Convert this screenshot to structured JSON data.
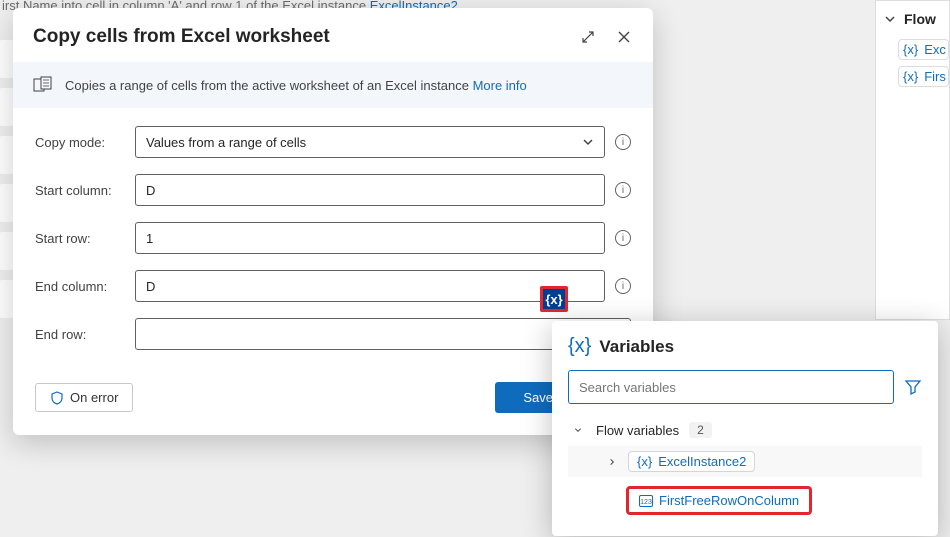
{
  "bg": {
    "text_prefix": "irst Name into cell in column 'A' and row 1 of the Excel instance",
    "text_link": "ExcelInstance2"
  },
  "right_panel": {
    "title": "Flow",
    "vars": [
      "Exc",
      "Firs"
    ]
  },
  "dialog": {
    "title": "Copy cells from Excel worksheet",
    "info": "Copies a range of cells from the active worksheet of an Excel instance",
    "more": "More info",
    "fields": {
      "copy_mode_label": "Copy mode:",
      "copy_mode_value": "Values from a range of cells",
      "start_col_label": "Start column:",
      "start_col_value": "D",
      "start_row_label": "Start row:",
      "start_row_value": "1",
      "end_col_label": "End column:",
      "end_col_value": "D",
      "end_row_label": "End row:",
      "end_row_value": ""
    },
    "expand_badge": "{x}",
    "on_error": "On error",
    "save": "Save"
  },
  "var_popup": {
    "title": "Variables",
    "search_placeholder": "Search variables",
    "group_label": "Flow variables",
    "group_count": "2",
    "vars": [
      {
        "name": "ExcelInstance2",
        "icon": "brace"
      },
      {
        "name": "FirstFreeRowOnColumn",
        "icon": "num"
      }
    ]
  }
}
